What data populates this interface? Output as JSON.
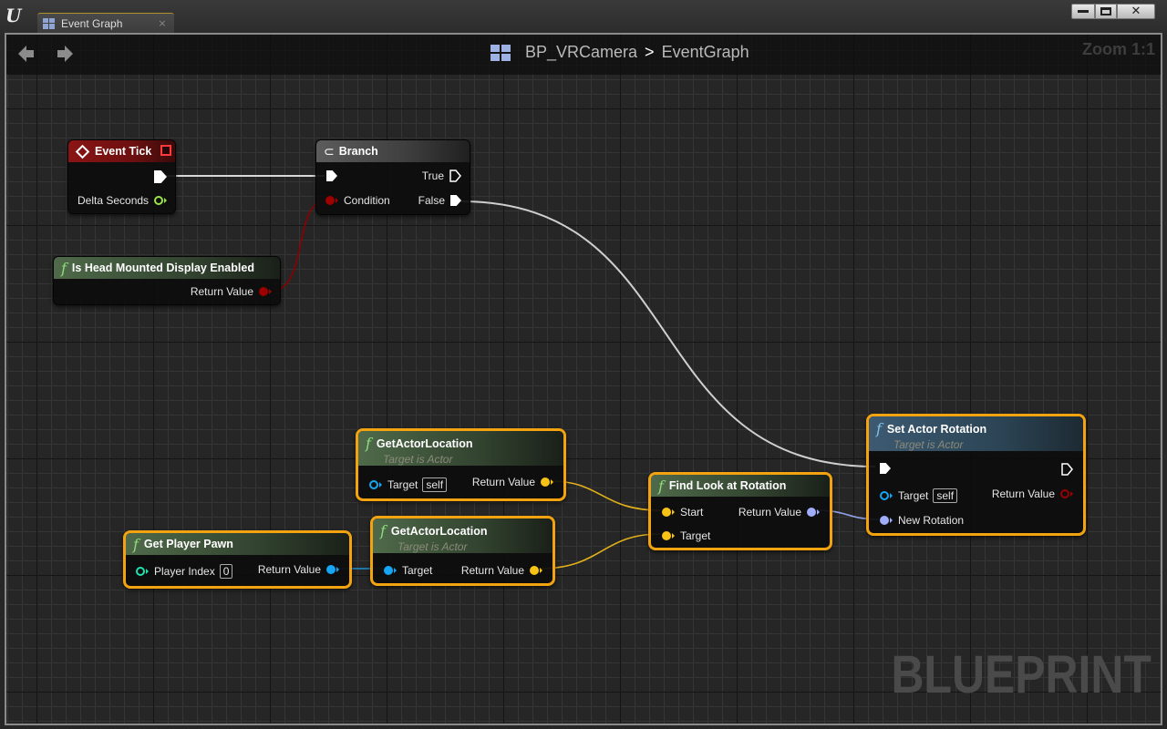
{
  "window": {
    "tab_label": "Event Graph",
    "tab_close": "×",
    "controls": {
      "minimize": "—",
      "maximize": "□",
      "close": "✕"
    }
  },
  "toolbar": {
    "back_icon": "arrow-left-icon",
    "forward_icon": "arrow-right-icon",
    "back": "🡄",
    "forward": "🡆",
    "breadcrumb": [
      "BP_VRCamera",
      "EventGraph"
    ],
    "separator": ">",
    "zoom": "Zoom 1:1"
  },
  "watermark": "BLUEPRINT",
  "nodes": {
    "event_tick": {
      "title": "Event Tick",
      "pins": {
        "out_exec": "",
        "delta_seconds": "Delta Seconds"
      }
    },
    "branch": {
      "title": "Branch",
      "pins": {
        "condition": "Condition",
        "true": "True",
        "false": "False"
      }
    },
    "is_hmd_enabled": {
      "title": "Is Head Mounted Display Enabled",
      "pins": {
        "return_value": "Return Value"
      }
    },
    "get_actor_location_1": {
      "title": "GetActorLocation",
      "subtitle": "Target is Actor",
      "pins": {
        "target": "Target",
        "target_default": "self",
        "return_value": "Return Value"
      }
    },
    "get_actor_location_2": {
      "title": "GetActorLocation",
      "subtitle": "Target is Actor",
      "pins": {
        "target": "Target",
        "return_value": "Return Value"
      }
    },
    "get_player_pawn": {
      "title": "Get Player Pawn",
      "pins": {
        "player_index": "Player Index",
        "player_index_value": "0",
        "return_value": "Return Value"
      }
    },
    "find_look_at_rotation": {
      "title": "Find Look at Rotation",
      "pins": {
        "start": "Start",
        "target": "Target",
        "return_value": "Return Value"
      }
    },
    "set_actor_rotation": {
      "title": "Set Actor Rotation",
      "subtitle": "Target is Actor",
      "pins": {
        "target": "Target",
        "target_default": "self",
        "return_value": "Return Value",
        "new_rotation": "New Rotation"
      }
    }
  },
  "colors": {
    "exec": "#ffffff",
    "bool": "#9c0000",
    "float": "#9be44a",
    "vector": "#f7c315",
    "object": "#17a6f4",
    "int": "#1fe3af",
    "rotator": "#9fadfa",
    "selection": "#f2a30f"
  }
}
